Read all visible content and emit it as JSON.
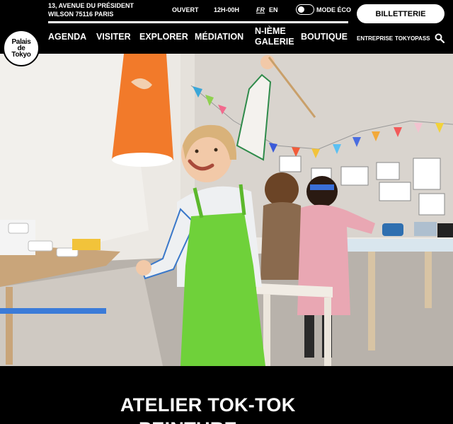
{
  "header": {
    "logo_text": "Palais\nde\nTokyo",
    "address": "13, AVENUE DU PRÉSIDENT\nWILSON 75116 PARIS",
    "status": "OUVERT",
    "hours": "12H-00H",
    "lang_fr": "FR",
    "lang_en": "EN",
    "eco_mode_label": "MODE ÉCO",
    "ticket_button": "BILLETTERIE"
  },
  "nav": {
    "items": [
      {
        "label": "AGENDA"
      },
      {
        "label": "VISITER"
      },
      {
        "label": "EXPLORER"
      },
      {
        "label": "MÉDIATION"
      },
      {
        "label": "N-IÈME\nGALERIE"
      },
      {
        "label": "BOUTIQUE"
      }
    ],
    "secondary": [
      {
        "label": "ENTREPRISE"
      },
      {
        "label": "TOKYOPASS"
      }
    ],
    "search_icon": "search-icon"
  },
  "hero": {
    "image_subject": "child in green apron at painting workshop"
  },
  "page": {
    "title_line1": "ATELIER TOK-TOK",
    "title_line2": "PEINTURE"
  },
  "colors": {
    "background": "#000000",
    "text": "#ffffff",
    "apron": "#6fd13a",
    "lantern": "#f27a2a"
  }
}
